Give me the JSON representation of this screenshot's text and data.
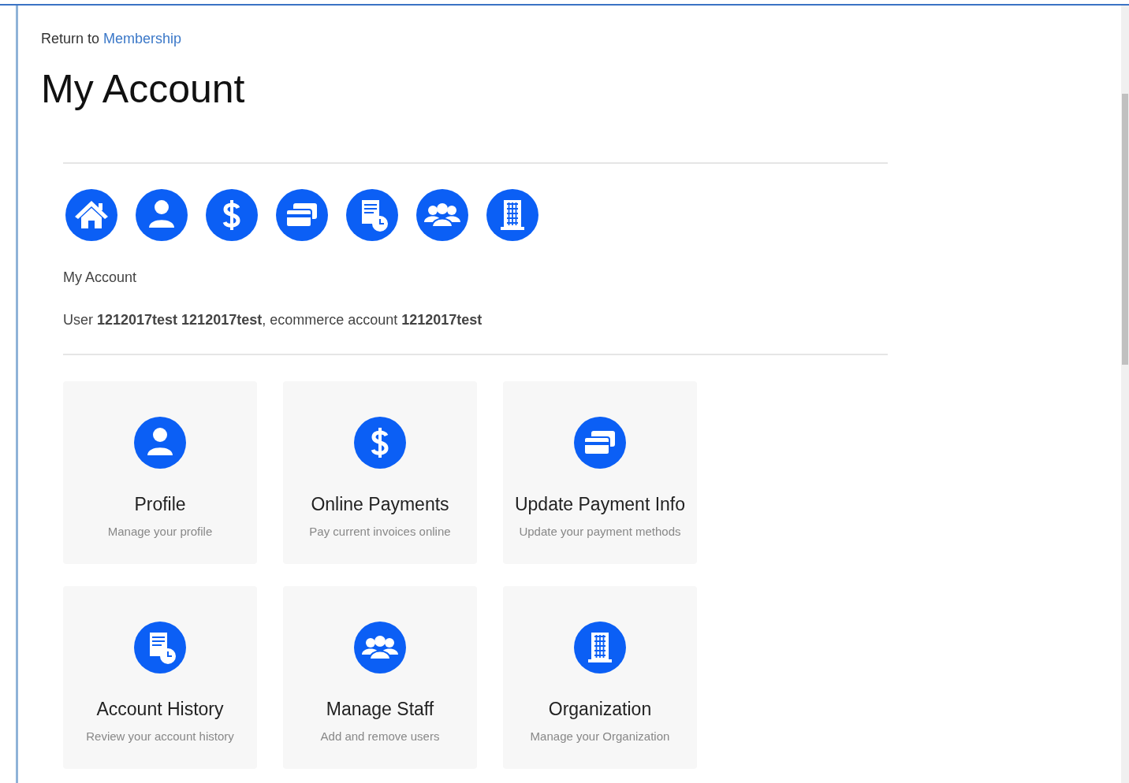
{
  "breadcrumb": {
    "prefix": "Return to",
    "link": "Membership"
  },
  "title": "My Account",
  "nav_icons": [
    {
      "kind": "home"
    },
    {
      "kind": "person"
    },
    {
      "kind": "dollar"
    },
    {
      "kind": "cards"
    },
    {
      "kind": "history"
    },
    {
      "kind": "people"
    },
    {
      "kind": "building"
    }
  ],
  "section_label": "My Account",
  "user_line": "User **1212017test 1212017test**, ecommerce account **1212017test**",
  "tiles": [
    {
      "kind": "person",
      "title": "Profile",
      "subtitle": "Manage your profile"
    },
    {
      "kind": "dollar",
      "title": "Online Payments",
      "subtitle": "Pay current invoices online"
    },
    {
      "kind": "cards",
      "title": "Update Payment Info",
      "subtitle": "Update your payment methods"
    },
    {
      "kind": "history",
      "title": "Account History",
      "subtitle": "Review your account history"
    },
    {
      "kind": "people",
      "title": "Manage Staff",
      "subtitle": "Add and remove users"
    },
    {
      "kind": "building",
      "title": "Organization",
      "subtitle": "Manage your Organization"
    }
  ]
}
